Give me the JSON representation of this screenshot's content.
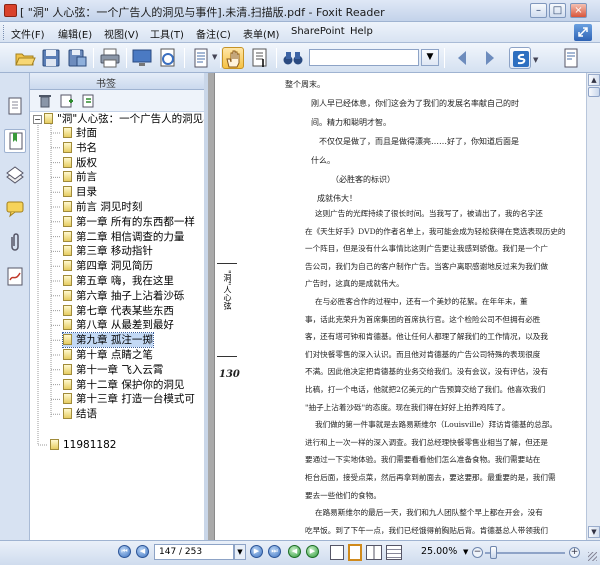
{
  "window": {
    "title": "[ \"洞\" 人心弦：一个广告人的洞见与事件].未清.扫描版.pdf - Foxit Reader"
  },
  "menu": [
    "文件(F)",
    "编辑(E)",
    "视图(V)",
    "工具(T)",
    "备注(C)",
    "表单(M)",
    "SharePoint",
    "Help"
  ],
  "panel": {
    "title": "书签"
  },
  "bookmarks": {
    "root": "\"洞\"人心弦：一个广告人的洞见与",
    "items": [
      "封面",
      "书名",
      "版权",
      "前言",
      "目录",
      "前言  洞见时刻",
      "第一章  所有的东西都一样",
      "第二章  相信调查的力量",
      "第三章  移动指针",
      "第四章  洞见简历",
      "第五章  嗨，我在这里",
      "第六章  抽子上沾着沙砾",
      "第七章  代表某些东西",
      "第八章  从最差到最好",
      "第九章  孤注一掷",
      "第十章  点睛之笔",
      "第十一章  飞入云霄",
      "第十二章  保护你的洞见",
      "第十三章  打造一台模式可",
      "结语"
    ],
    "last": "11981182",
    "selected_index": 14
  },
  "document": {
    "page_number": "130",
    "side_label": "\"洞\"人心弦",
    "top_lines": [
      "整个周末。",
      "刚人早已经体息，你们这会为了我们的发展名率献自己的时",
      "间。精力和聪明才智。",
      "不仅仅是做了，而且是做得漂亮……好了，你知道后面是",
      "什么。",
      "（必胜客的标识）",
      "成就伟大！"
    ],
    "body_lines": [
      "这则广告的光辉持续了很长时间。当我写了，被请出了，我的名字还",
      "在《天生好手》DVD的作者名单上，我可能会成为轻松获得在竞选表现历史的",
      "一个阵目，但是没有什么事情比这则广告更让我感到骄傲。我们是一个广",
      "告公司，我们为自己的客户制作广告。当客户离职感谢地反过来为我们做",
      "广告时，这真的是成就伟大。",
      "在与必胜客合作的过程中，还有一个美妙的花絮。在年年末，董",
      "事，话此克荣升为首席集团的首席执行官。这个检险公司不但拥有必胜",
      "客，还有塔可钟和肯德基。他让任何人都理了解我们的工作情况，以及我",
      "们对快餐零售的深入认识。而且他对肯德基的广告公司特殊的表现很度",
      "不满。因此他决定把肯德基的业务交给我们。没有会议，没有评估，没有",
      "比稿，打一个电话，他就把2亿美元的广告预算交给了我们。他喜欢我们",
      "\"抽子上沾着沙砾\"的态度。现在我们得在好好上拍养鸡阵了。",
      "我们做的第一件事就是去路易斯维尔（Louisville）拜访肯德基的总部。",
      "进行和上一次一样的深入调查。我们总经理快餐零售业相当了解，但还是",
      "要通过一下实地体验。我们需要看看他们怎么准备食物。我们需要站在",
      "柜台后面，接受点菜，然后再拿到前面去，要这要那。最重要的是，我们需",
      "要去一些他们的食物。",
      "在路易斯维尔的最后一天，我们和九人团队整个早上都在开会，没有",
      "吃早饭。到了下午一点，我们已经饿得前胸贴后背。肯德基总人带领我们",
      "沿着一条走廊走进他们的试做厨房。那儿已经为我们准备好了一桶套，",
      "知名的和正在开发中的产品应有尽有。我们放怀享地吃了一个多小时，嘲着"
    ]
  },
  "status": {
    "page_field": "147 / 253",
    "zoom": "25.00%"
  },
  "colors": {
    "chrome": "#c9d6e8",
    "accent": "#3f74c2",
    "selection": "#c3d9f5"
  }
}
